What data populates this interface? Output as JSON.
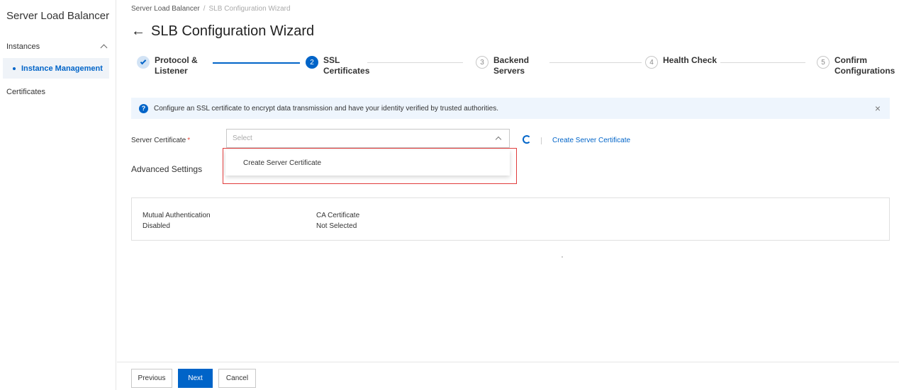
{
  "sidebar": {
    "title": "Server Load Balancer",
    "group_label": "Instances",
    "active_item": "Instance Management",
    "item_certificates": "Certificates"
  },
  "breadcrumb": {
    "root": "Server Load Balancer",
    "separator": "/",
    "current": "SLB Configuration Wizard"
  },
  "page": {
    "back_arrow": "←",
    "title": "SLB Configuration Wizard"
  },
  "steps": [
    {
      "number": "",
      "label_line1": "Protocol &",
      "label_line2": "Listener",
      "status": "done"
    },
    {
      "number": "2",
      "label_line1": "SSL",
      "label_line2": "Certificates",
      "status": "active"
    },
    {
      "number": "3",
      "label_line1": "Backend",
      "label_line2": "Servers",
      "status": "todo"
    },
    {
      "number": "4",
      "label_line1": "Health Check",
      "label_line2": "",
      "status": "todo"
    },
    {
      "number": "5",
      "label_line1": "Confirm",
      "label_line2": "Configurations",
      "status": "todo"
    }
  ],
  "banner": {
    "icon": "?",
    "text": "Configure an SSL certificate to encrypt data transmission and have your identity verified by trusted authorities.",
    "close": "×"
  },
  "form": {
    "server_certificate_label": "Server Certificate",
    "required_mark": "*",
    "select_placeholder": "Select",
    "create_link": "Create Server Certificate",
    "advanced_settings": "Advanced Settings"
  },
  "dropdown": {
    "option": "Create Server Certificate"
  },
  "advanced": {
    "mutual_auth_label": "Mutual Authentication",
    "mutual_auth_value": "Disabled",
    "ca_cert_label": "CA Certificate",
    "ca_cert_value": "Not Selected"
  },
  "footer": {
    "previous": "Previous",
    "next": "Next",
    "cancel": "Cancel"
  },
  "colors": {
    "accent": "#0064c8",
    "highlight": "#e03c3c"
  }
}
